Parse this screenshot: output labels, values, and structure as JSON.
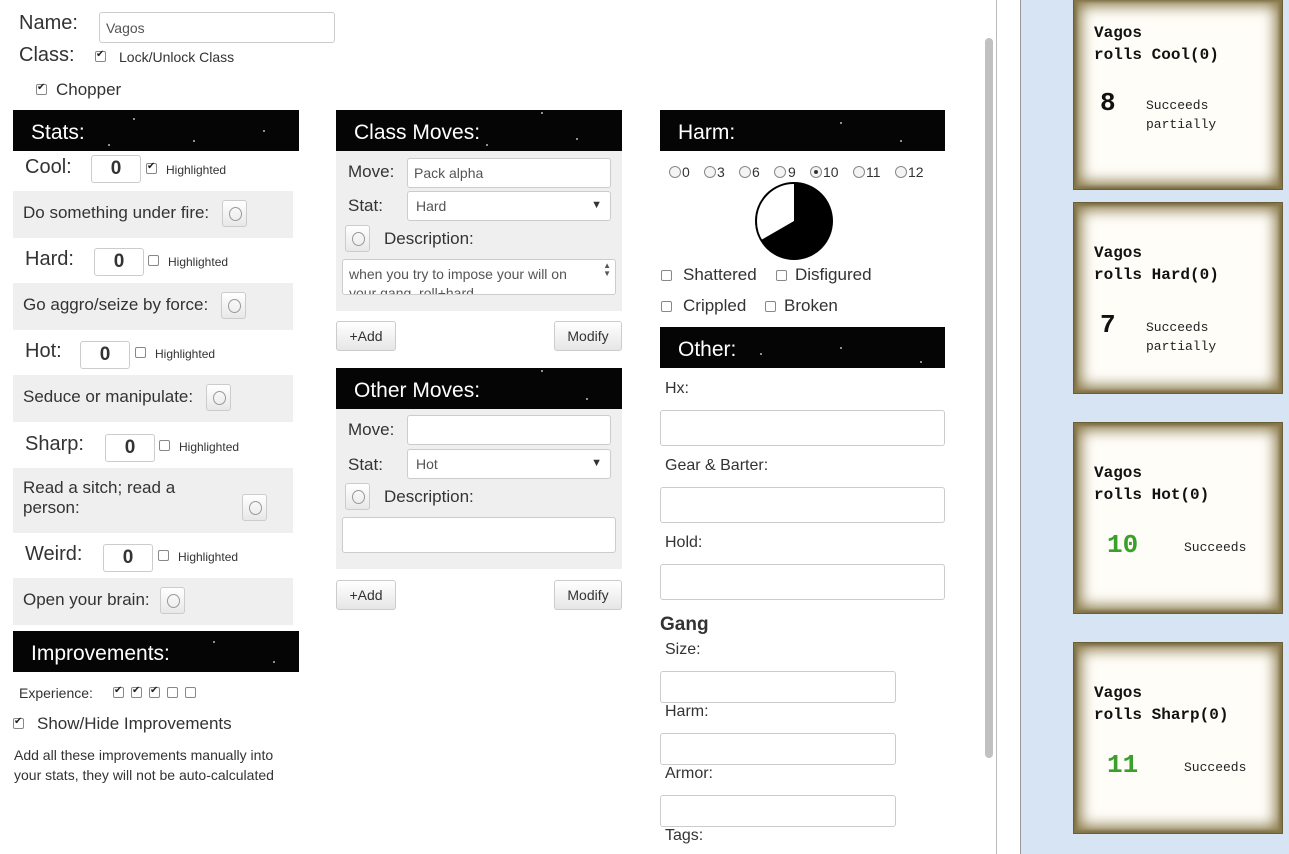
{
  "name": {
    "label": "Name:",
    "value": "Vagos"
  },
  "class": {
    "label": "Class:",
    "lock_label": "Lock/Unlock Class",
    "class_name": "Chopper"
  },
  "stats": {
    "header": "Stats:",
    "highlight_label": "Highlighted",
    "items": [
      {
        "name": "Cool:",
        "value": "0",
        "highlighted": true,
        "move": "Do something under fire:"
      },
      {
        "name": "Hard:",
        "value": "0",
        "highlighted": false,
        "move": "Go aggro/seize by force:"
      },
      {
        "name": "Hot:",
        "value": "0",
        "highlighted": false,
        "move": "Seduce or manipulate:"
      },
      {
        "name": "Sharp:",
        "value": "0",
        "highlighted": false,
        "move_line1": "Read a sitch; read a",
        "move_line2": "person:"
      },
      {
        "name": "Weird:",
        "value": "0",
        "highlighted": false,
        "move": "Open your brain:"
      }
    ]
  },
  "improvements": {
    "header": "Improvements:",
    "experience_label": "Experience:",
    "experience": [
      true,
      true,
      true,
      false,
      false
    ],
    "toggle_label": "Show/Hide Improvements",
    "note_line1": "Add all these improvements manually into",
    "note_line2": "your stats, they will not be auto-calculated"
  },
  "class_moves": {
    "header": "Class Moves:",
    "move_label": "Move:",
    "move_value": "Pack alpha",
    "stat_label": "Stat:",
    "stat_value": "Hard",
    "desc_label": "Description:",
    "desc_line1": "when you try to impose your will on",
    "desc_line2": "your gang, roll+hard",
    "add": "+Add",
    "modify": "Modify"
  },
  "other_moves": {
    "header": "Other Moves:",
    "move_label": "Move:",
    "move_value": "",
    "stat_label": "Stat:",
    "stat_value": "Hot",
    "desc_label": "Description:",
    "add": "+Add",
    "modify": "Modify"
  },
  "harm": {
    "header": "Harm:",
    "options": [
      "0",
      "3",
      "6",
      "9",
      "10",
      "11",
      "12"
    ],
    "selected": "10",
    "conditions": {
      "shattered": "Shattered",
      "disfigured": "Disfigured",
      "crippled": "Crippled",
      "broken": "Broken"
    }
  },
  "other": {
    "header": "Other:",
    "hx": "Hx:",
    "gear": "Gear & Barter:",
    "hold": "Hold:",
    "gang_title": "Gang",
    "size": "Size:",
    "harm": "Harm:",
    "armor": "Armor:",
    "tags": "Tags:"
  },
  "rolls": [
    {
      "who": "Vagos",
      "action": "rolls Cool(0)",
      "total": "8",
      "result_line1": "Succeeds",
      "result_line2": "partially",
      "color": "#111111"
    },
    {
      "who": "Vagos",
      "action": "rolls Hard(0)",
      "total": "7",
      "result_line1": "Succeeds",
      "result_line2": "partially",
      "color": "#111111"
    },
    {
      "who": "Vagos",
      "action": "rolls Hot(0)",
      "total": "10",
      "result_line1": "Succeeds",
      "result_line2": "",
      "color": "#3aa02a"
    },
    {
      "who": "Vagos",
      "action": "rolls Sharp(0)",
      "total": "11",
      "result_line1": "Succeeds",
      "result_line2": "",
      "color": "#3aa02a"
    }
  ],
  "colors": {
    "header_bg": "#050505",
    "panel_bg": "#efefef",
    "sidebar_bg": "#d6e4f3",
    "success": "#3aa02a"
  }
}
